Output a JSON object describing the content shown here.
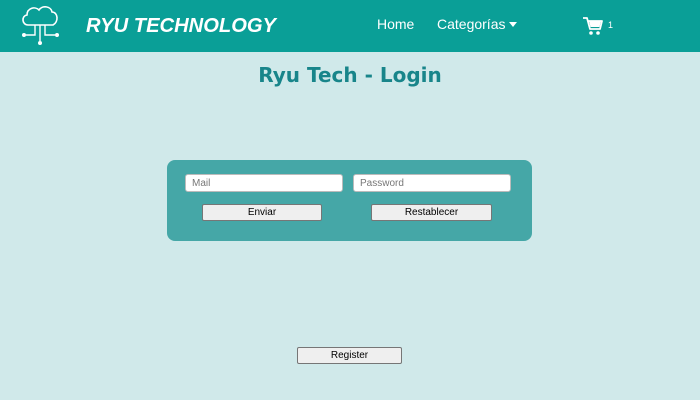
{
  "navbar": {
    "brand": "RYU TECHNOLOGY",
    "links": {
      "home": "Home",
      "categories": "Categorías"
    },
    "cart_count": "1",
    "icons": {
      "logo": "cloud-circuit-icon",
      "cart": "shopping-cart-icon",
      "dropdown": "caret-down-icon"
    }
  },
  "page": {
    "title": "Ryu Tech - Login"
  },
  "login": {
    "mail_placeholder": "Mail",
    "password_placeholder": "Password",
    "submit_label": "Enviar",
    "reset_label": "Restablecer"
  },
  "register": {
    "label": "Register"
  },
  "colors": {
    "navbar": "#0a9f97",
    "background": "#d0e9ea",
    "card": "#45a7a7",
    "title": "#18858a"
  }
}
